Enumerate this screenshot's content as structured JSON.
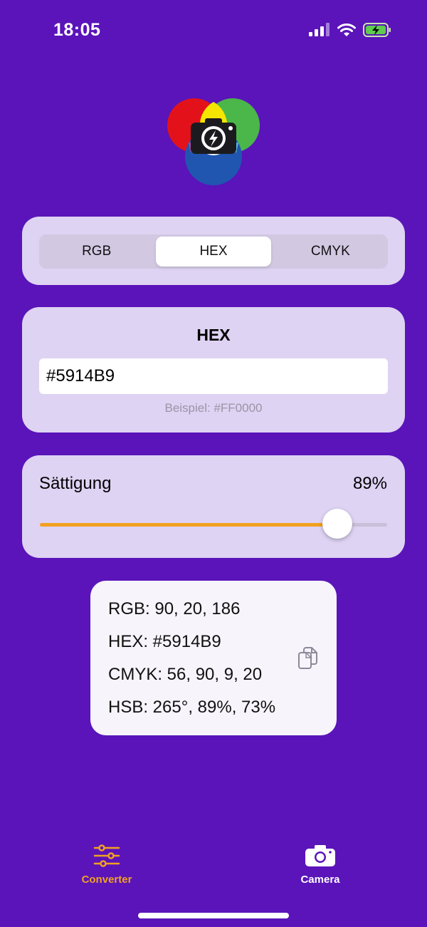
{
  "status_bar": {
    "time": "18:05"
  },
  "segments": [
    "RGB",
    "HEX",
    "CMYK"
  ],
  "active_segment": 1,
  "hex_card": {
    "title": "HEX",
    "value": "#5914B9",
    "hint": "Beispiel: #FF0000"
  },
  "saturation": {
    "label": "Sättigung",
    "value_text": "89%",
    "value": 0.89
  },
  "result": {
    "rgb": "RGB: 90, 20, 186",
    "hex": "HEX: #5914B9",
    "cmyk": "CMYK: 56, 90, 9, 20",
    "hsb": "HSB: 265°, 89%, 73%"
  },
  "tabs": [
    {
      "label": "Converter",
      "icon": "sliders-icon",
      "active": true
    },
    {
      "label": "Camera",
      "icon": "camera-icon",
      "active": false
    }
  ],
  "colors": {
    "background": "#5A14B9",
    "accent": "#F2A120",
    "card": "#DED3F3"
  }
}
